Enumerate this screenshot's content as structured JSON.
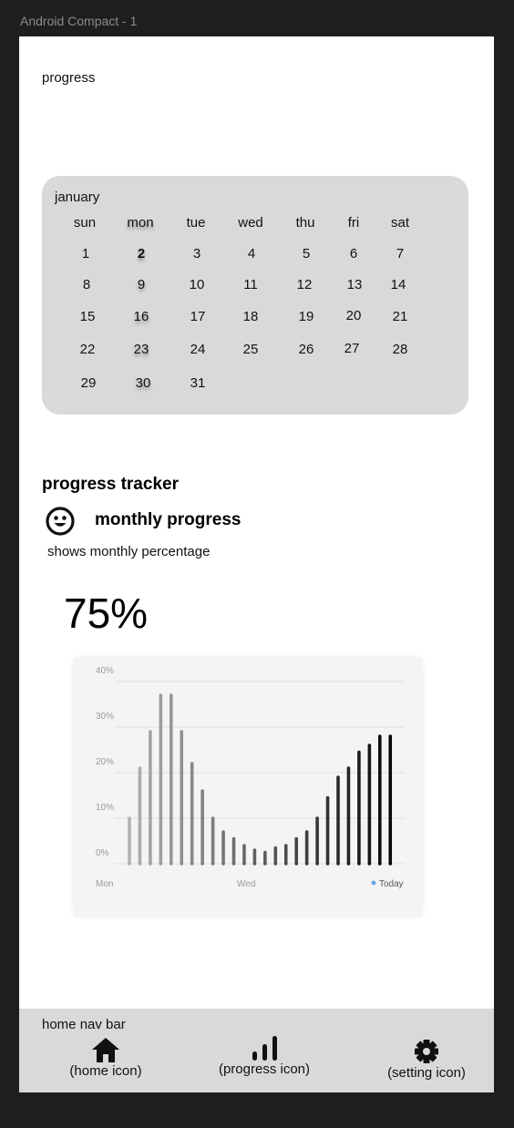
{
  "frame_title": "Android Compact - 1",
  "page_heading": "progress",
  "calendar": {
    "month": "january",
    "weekdays": [
      "sun",
      "mon",
      "tue",
      "wed",
      "thu",
      "fri",
      "sat"
    ],
    "weeks": [
      [
        "1",
        "2",
        "3",
        "4",
        "5",
        "6",
        "7"
      ],
      [
        "8",
        "9",
        "10",
        "11",
        "12",
        "13",
        "14"
      ],
      [
        "15",
        "16",
        "17",
        "18",
        "19",
        "20",
        "21"
      ],
      [
        "22",
        "23",
        "24",
        "25",
        "26",
        "27",
        "28"
      ],
      [
        "29",
        "30",
        "31",
        "",
        "",
        "",
        ""
      ]
    ],
    "today": "2"
  },
  "tracker": {
    "title": "progress tracker",
    "icon": "smiley-face-icon",
    "monthly_title": "monthly progress",
    "monthly_subtitle": "shows monthly percentage",
    "percent": "75%"
  },
  "chart_data": {
    "type": "bar",
    "ytick_labels": [
      "40%",
      "30%",
      "20%",
      "10%",
      "0%"
    ],
    "yticks": [
      40,
      30,
      20,
      10,
      0
    ],
    "ylim": [
      0,
      40
    ],
    "x_labels": [
      "Mon",
      "Wed"
    ],
    "legend": "Today",
    "legend_color": "#6aa6e6",
    "values": [
      10,
      21,
      29,
      37,
      37,
      29,
      22,
      16,
      10,
      7,
      5.5,
      4,
      3,
      2.5,
      3.5,
      4,
      5.5,
      7,
      10,
      14.5,
      19,
      21,
      24.5,
      26,
      28,
      28
    ],
    "grid": true
  },
  "navbar": {
    "title": "home nav bar",
    "items": [
      {
        "label": "(home icon)",
        "icon": "home-icon"
      },
      {
        "label": "(progress icon)",
        "icon": "bar-chart-icon"
      },
      {
        "label": "(setting icon)",
        "icon": "gear-icon"
      }
    ]
  },
  "colors": {
    "background": "#1e1e1e",
    "surface": "#ffffff",
    "panel": "#d9d9d9",
    "text": "#111111"
  }
}
